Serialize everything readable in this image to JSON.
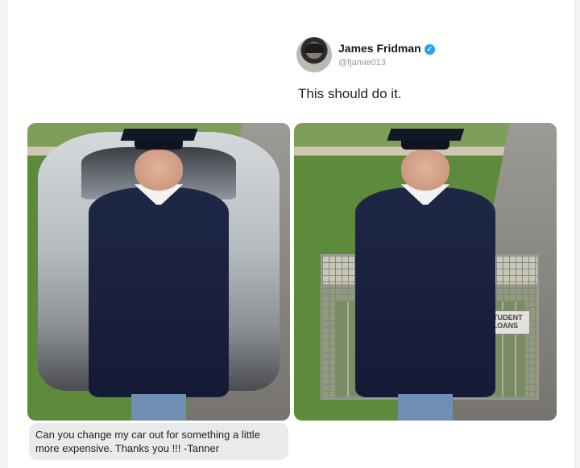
{
  "tweet": {
    "author_name": "James Fridman",
    "verified_mark": "✓",
    "handle": "@fjamie013",
    "text": "This should do it."
  },
  "photos": {
    "left": {
      "icon": "graduate-with-car-photo"
    },
    "right": {
      "icon": "graduate-with-student-loans-photo",
      "sign_line1": "STUDENT",
      "sign_line2": "LOANS"
    }
  },
  "request": {
    "caption": "Can you change my car out for something a little more expensive. Thanks you !!! -Tanner"
  },
  "colors": {
    "verified": "#1da1f2",
    "gown": "#1f2747",
    "caption_bg": "#e9eaec"
  }
}
